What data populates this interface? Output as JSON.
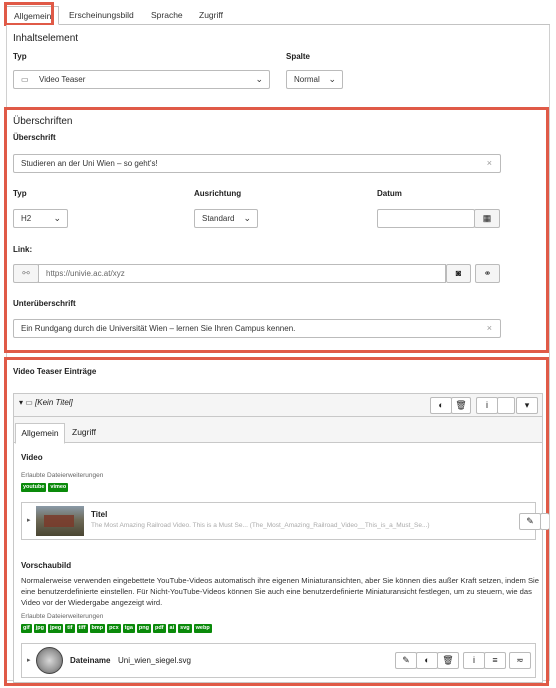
{
  "top_tabs": [
    "Allgemein",
    "Erscheinungsbild",
    "Sprache",
    "Zugriff"
  ],
  "inhaltselement": {
    "title": "Inhaltselement",
    "typ_label": "Typ",
    "typ_value": "Video Teaser",
    "spalte_label": "Spalte",
    "spalte_value": "Normal"
  },
  "ueberschriften": {
    "title": "Überschriften",
    "ueberschrift_label": "Überschrift",
    "ueberschrift_value": "Studieren an der Uni Wien – so geht's!",
    "typ_label": "Typ",
    "typ_value": "H2",
    "ausrichtung_label": "Ausrichtung",
    "ausrichtung_value": "Standard",
    "datum_label": "Datum",
    "datum_value": "",
    "link_label": "Link:",
    "link_value": "https://univie.ac.at/xyz",
    "unterueberschrift_label": "Unterüberschrift",
    "unterueberschrift_value": "Ein Rundgang durch die Universität Wien – lernen Sie Ihren Campus kennen."
  },
  "entries": {
    "title": "Video Teaser Einträge",
    "item_title": "[Kein Titel]",
    "tabs": [
      "Allgemein",
      "Zugriff"
    ],
    "video_label": "Video",
    "allowed_label": "Erlaubte Dateierweiterungen",
    "video_ext": [
      "youtube",
      "vimeo"
    ],
    "video_item_title": "Titel",
    "video_item_desc": "The Most Amazing Railroad Video. This is a Must Se... (The_Most_Amazing_Railroad_Video__This_is_a_Must_Se...)",
    "vorschau_label": "Vorschaubild",
    "vorschau_desc": "Normalerweise verwenden eingebettete YouTube-Videos automatisch ihre eigenen Miniaturansichten, aber Sie können dies außer Kraft setzen, indem Sie eine benutzerdefinierte einstellen. Für Nicht-YouTube-Videos können Sie auch eine benutzerdefinierte Miniaturansicht festlegen, um zu steuern, wie das Video vor der Wiedergabe angezeigt wird.",
    "image_ext": [
      "gif",
      "jpg",
      "jpeg",
      "tif",
      "tiff",
      "bmp",
      "pcx",
      "tga",
      "png",
      "pdf",
      "ai",
      "svg",
      "webp"
    ],
    "file_label": "Dateiname",
    "file_name": "Uni_wien_siegel.svg"
  },
  "colors": {
    "highlight": "#e05a47",
    "badge": "#0a8a0a"
  }
}
